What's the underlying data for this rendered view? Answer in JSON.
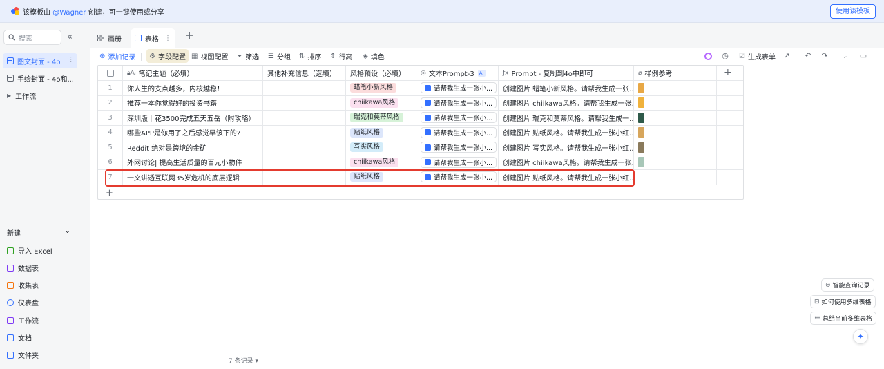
{
  "banner": {
    "prefix": "该模板由",
    "user": "@Wagner",
    "suffix": "创建，可一键使用或分享",
    "use_button": "使用该模板"
  },
  "sidebar": {
    "search_placeholder": "搜索",
    "items": [
      {
        "label": "图文封面 - 4o",
        "active": true
      },
      {
        "label": "手绘封面 - 4o和...",
        "active": false
      },
      {
        "label": "工作流",
        "active": false
      }
    ],
    "new_section": {
      "title": "新建",
      "items": [
        {
          "label": "导入 Excel",
          "icon": "excel-icon",
          "color": "#2ea121"
        },
        {
          "label": "数据表",
          "icon": "table-icon",
          "color": "#7f3bf5"
        },
        {
          "label": "收集表",
          "icon": "form-icon",
          "color": "#f5740d"
        },
        {
          "label": "仪表盘",
          "icon": "dashboard-icon",
          "color": "#3370ff"
        },
        {
          "label": "工作流",
          "icon": "workflow-icon",
          "color": "#7f3bf5"
        },
        {
          "label": "文档",
          "icon": "doc-icon",
          "color": "#3370ff"
        },
        {
          "label": "文件夹",
          "icon": "folder-icon",
          "color": "#3370ff"
        }
      ]
    }
  },
  "tabs": [
    {
      "label": "画册",
      "active": false
    },
    {
      "label": "表格",
      "active": true
    }
  ],
  "toolbar": {
    "add_record": "添加记录",
    "field_config": "字段配置",
    "view_config": "视图配置",
    "filter": "筛选",
    "group": "分组",
    "sort": "排序",
    "row_height": "行高",
    "fill_color": "填色",
    "generate_form": "生成表单"
  },
  "table": {
    "columns": [
      {
        "label": "笔记主题（必填）",
        "icon": "lock-text-icon"
      },
      {
        "label": "其他补充信息（选填）",
        "icon": ""
      },
      {
        "label": "风格预设（必填）",
        "icon": ""
      },
      {
        "label": "文本Prompt-3",
        "icon": "ai-text-icon",
        "badge": "AI"
      },
      {
        "label": "Prompt - 复制到4o中即可",
        "icon": "formula-icon"
      },
      {
        "label": "样例参考",
        "icon": "attachment-icon"
      }
    ],
    "rows": [
      {
        "num": "1",
        "topic": "你人生的支点越多，内核越稳！",
        "extra": "",
        "style": "蜡笔小新风格",
        "style_color": "#fbdcdc",
        "prompt3": "请帮我生成一张小...",
        "prompt": "创建图片 蜡笔小新风格。请帮我生成一张...",
        "thumb_color": "#e8a846"
      },
      {
        "num": "2",
        "topic": "推荐一本你觉得好的投资书籍",
        "extra": "",
        "style": "chiikawa风格",
        "style_color": "#fbe0ef",
        "prompt3": "请帮我生成一张小...",
        "prompt": "创建图片 chiikawa风格。请帮我生成一张...",
        "thumb_color": "#f0b23c"
      },
      {
        "num": "3",
        "topic": "深圳版｜花3500完成五天五岳（附攻略）",
        "extra": "",
        "style": "瑞克和莫蒂风格",
        "style_color": "#d6f2d8",
        "prompt3": "请帮我生成一张小...",
        "prompt": "创建图片 瑞克和莫蒂风格。请帮我生成一...",
        "thumb_color": "#2f5a4a"
      },
      {
        "num": "4",
        "topic": "哪些APP是你用了之后感觉早该下的?",
        "extra": "",
        "style": "贴纸风格",
        "style_color": "#dce6fb",
        "prompt3": "请帮我生成一张小...",
        "prompt": "创建图片 贴纸风格。请帮我生成一张小红...",
        "thumb_color": "#d7a65c"
      },
      {
        "num": "5",
        "topic": "Reddit 绝对是跨境的金矿",
        "extra": "",
        "style": "写实风格",
        "style_color": "#d3ecf9",
        "prompt3": "请帮我生成一张小...",
        "prompt": "创建图片 写实风格。请帮我生成一张小红...",
        "thumb_color": "#8a7a5c"
      },
      {
        "num": "6",
        "topic": "外网讨论| 提高生活质量的百元小物件",
        "extra": "",
        "style": "chiikawa风格",
        "style_color": "#fbe0ef",
        "prompt3": "请帮我生成一张小...",
        "prompt": "创建图片 chiikawa风格。请帮我生成一张...",
        "thumb_color": "#a8c7b8"
      },
      {
        "num": "7",
        "topic": "一文讲透互联网35岁危机的底层逻辑",
        "extra": "",
        "style": "贴纸风格",
        "style_color": "#dce6fb",
        "prompt3": "请帮我生成一张小...",
        "prompt": "创建图片 贴纸风格。请帮我生成一张小红...",
        "thumb_color": ""
      }
    ]
  },
  "footer": {
    "count": "7 条记录"
  },
  "floating": {
    "smart_query": "智能查询记录",
    "how_to_use": "如何使用多维表格",
    "summarize": "总结当前多维表格"
  },
  "colors": {
    "accent": "#3370ff",
    "highlight": "#e43b2f"
  }
}
